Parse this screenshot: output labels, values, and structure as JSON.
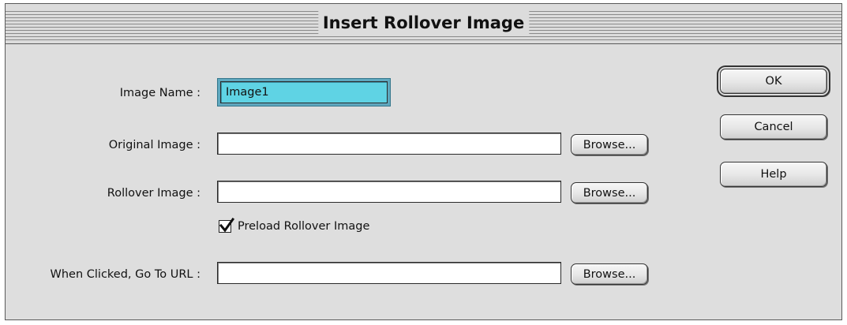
{
  "window": {
    "title": "Insert Rollover Image"
  },
  "form": {
    "image_name": {
      "label": "Image Name :",
      "value": "Image1"
    },
    "original_image": {
      "label": "Original Image :",
      "value": "",
      "browse_label": "Browse..."
    },
    "rollover_image": {
      "label": "Rollover Image :",
      "value": "",
      "browse_label": "Browse..."
    },
    "preload": {
      "label": "Preload Rollover Image",
      "checked": true
    },
    "url": {
      "label": "When Clicked, Go To URL :",
      "value": "",
      "browse_label": "Browse..."
    }
  },
  "buttons": {
    "ok": "OK",
    "cancel": "Cancel",
    "help": "Help"
  },
  "colors": {
    "focused_field": "#5fd3e4",
    "window_background": "#dedede"
  },
  "icons": {
    "checkbox": "checkmark-icon"
  }
}
